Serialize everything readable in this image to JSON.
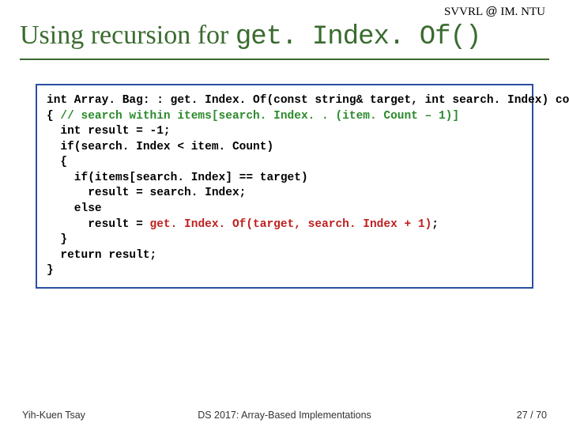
{
  "header": {
    "lab": "SVVRL",
    "at": "@",
    "dept": "IM. NTU"
  },
  "title": {
    "prefix": "Using recursion for ",
    "mono": "get. Index. Of()"
  },
  "code": {
    "l1": "int Array. Bag: : get. Index. Of(const string& target, int search. Index) const",
    "l2a": "{ ",
    "l2b": "// search within items[search. Index. . (item. Count – 1)]",
    "l3": "  int result = -1;",
    "l4": "  if(search. Index < item. Count)",
    "l5": "  {",
    "l6": "    if(items[search. Index] == target)",
    "l7": "      result = search. Index;",
    "l8": "    else",
    "l9a": "      result = ",
    "l9b": "get. Index. Of(target, search. Index + 1)",
    "l9c": ";",
    "l10": "  }",
    "l11": "  return result;",
    "l12": "}"
  },
  "footer": {
    "author": "Yih-Kuen Tsay",
    "course": "DS 2017: Array-Based Implementations",
    "page": "27 / 70"
  }
}
